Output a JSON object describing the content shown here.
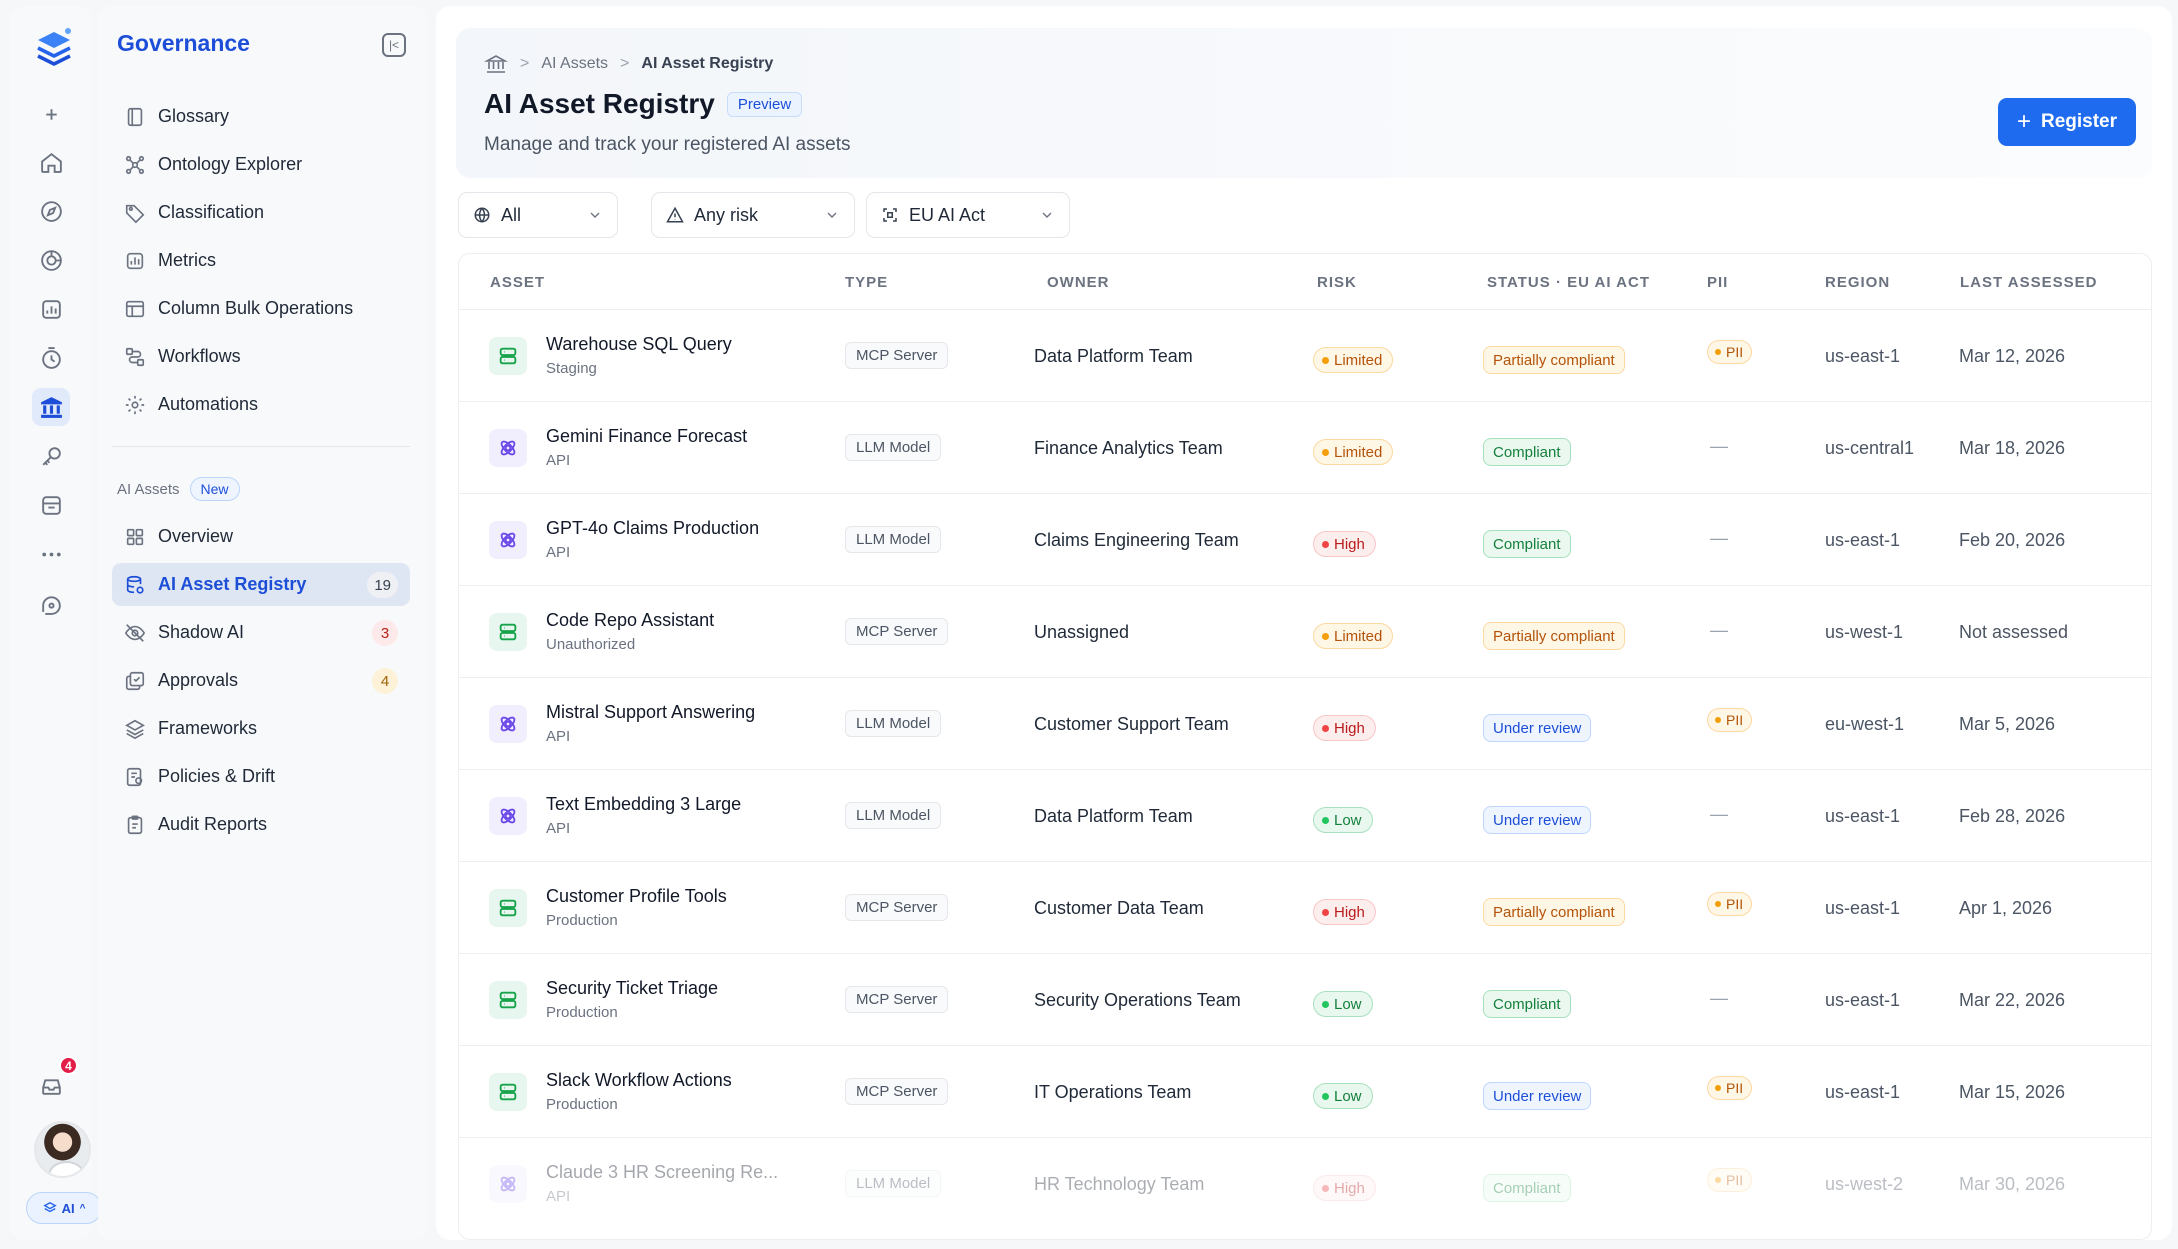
{
  "rail": {
    "notification_count": "4",
    "ai_label": "AI"
  },
  "sidebar": {
    "title": "Governance",
    "items": [
      {
        "label": "Glossary",
        "icon": "book-icon"
      },
      {
        "label": "Ontology Explorer",
        "icon": "graph-icon"
      },
      {
        "label": "Classification",
        "icon": "tag-icon"
      },
      {
        "label": "Metrics",
        "icon": "chart-icon"
      },
      {
        "label": "Column Bulk Operations",
        "icon": "table-icon"
      },
      {
        "label": "Workflows",
        "icon": "workflow-icon"
      },
      {
        "label": "Automations",
        "icon": "automation-icon"
      }
    ],
    "ai_section": {
      "label": "AI Assets",
      "badge": "New",
      "items": [
        {
          "label": "Overview",
          "icon": "grid-icon",
          "count": ""
        },
        {
          "label": "AI Asset Registry",
          "icon": "registry-icon",
          "count": "19"
        },
        {
          "label": "Shadow AI",
          "icon": "eye-off-icon",
          "count": "3"
        },
        {
          "label": "Approvals",
          "icon": "approval-icon",
          "count": "4"
        },
        {
          "label": "Frameworks",
          "icon": "layers-icon",
          "count": ""
        },
        {
          "label": "Policies & Drift",
          "icon": "policy-icon",
          "count": ""
        },
        {
          "label": "Audit Reports",
          "icon": "clipboard-icon",
          "count": ""
        }
      ]
    }
  },
  "header": {
    "breadcrumb": [
      "AI Assets",
      "AI Asset Registry"
    ],
    "title": "AI Asset Registry",
    "badge": "Preview",
    "subtitle": "Manage and track your registered AI assets",
    "register_label": "Register"
  },
  "filters": [
    {
      "label": "All",
      "icon": "globe-icon"
    },
    {
      "label": "Any risk",
      "icon": "warning-icon"
    },
    {
      "label": "EU AI Act",
      "icon": "scan-icon"
    }
  ],
  "table": {
    "columns": [
      "ASSET",
      "TYPE",
      "OWNER",
      "RISK",
      "STATUS · EU AI ACT",
      "PII",
      "REGION",
      "LAST ASSESSED"
    ],
    "rows": [
      {
        "name": "Warehouse SQL Query",
        "sub": "Staging",
        "kind": "mcp",
        "type": "MCP Server",
        "owner": "Data Platform Team",
        "risk": "Limited",
        "status": "Partially compliant",
        "pii": "PII",
        "region": "us-east-1",
        "assessed": "Mar 12, 2026"
      },
      {
        "name": "Gemini Finance Forecast",
        "sub": "API",
        "kind": "llm",
        "type": "LLM Model",
        "owner": "Finance Analytics Team",
        "risk": "Limited",
        "status": "Compliant",
        "pii": "—",
        "region": "us-central1",
        "assessed": "Mar 18, 2026"
      },
      {
        "name": "GPT-4o Claims Production",
        "sub": "API",
        "kind": "llm",
        "type": "LLM Model",
        "owner": "Claims Engineering Team",
        "risk": "High",
        "status": "Compliant",
        "pii": "—",
        "region": "us-east-1",
        "assessed": "Feb 20, 2026"
      },
      {
        "name": "Code Repo Assistant",
        "sub": "Unauthorized",
        "kind": "mcp",
        "type": "MCP Server",
        "owner": "Unassigned",
        "risk": "Limited",
        "status": "Partially compliant",
        "pii": "—",
        "region": "us-west-1",
        "assessed": "Not assessed"
      },
      {
        "name": "Mistral Support Answering",
        "sub": "API",
        "kind": "llm",
        "type": "LLM Model",
        "owner": "Customer Support Team",
        "risk": "High",
        "status": "Under review",
        "pii": "PII",
        "region": "eu-west-1",
        "assessed": "Mar 5, 2026"
      },
      {
        "name": "Text Embedding 3 Large",
        "sub": "API",
        "kind": "llm",
        "type": "LLM Model",
        "owner": "Data Platform Team",
        "risk": "Low",
        "status": "Under review",
        "pii": "—",
        "region": "us-east-1",
        "assessed": "Feb 28, 2026"
      },
      {
        "name": "Customer Profile Tools",
        "sub": "Production",
        "kind": "mcp",
        "type": "MCP Server",
        "owner": "Customer Data Team",
        "risk": "High",
        "status": "Partially compliant",
        "pii": "PII",
        "region": "us-east-1",
        "assessed": "Apr 1, 2026"
      },
      {
        "name": "Security Ticket Triage",
        "sub": "Production",
        "kind": "mcp",
        "type": "MCP Server",
        "owner": "Security Operations Team",
        "risk": "Low",
        "status": "Compliant",
        "pii": "—",
        "region": "us-east-1",
        "assessed": "Mar 22, 2026"
      },
      {
        "name": "Slack Workflow Actions",
        "sub": "Production",
        "kind": "mcp",
        "type": "MCP Server",
        "owner": "IT Operations Team",
        "risk": "Low",
        "status": "Under review",
        "pii": "PII",
        "region": "us-east-1",
        "assessed": "Mar 15, 2026"
      },
      {
        "name": "Claude 3 HR Screening Re...",
        "sub": "API",
        "kind": "llm",
        "type": "LLM Model",
        "owner": "HR Technology Team",
        "risk": "High",
        "status": "Compliant",
        "pii": "PII",
        "region": "us-west-2",
        "assessed": "Mar 30, 2026"
      }
    ]
  }
}
